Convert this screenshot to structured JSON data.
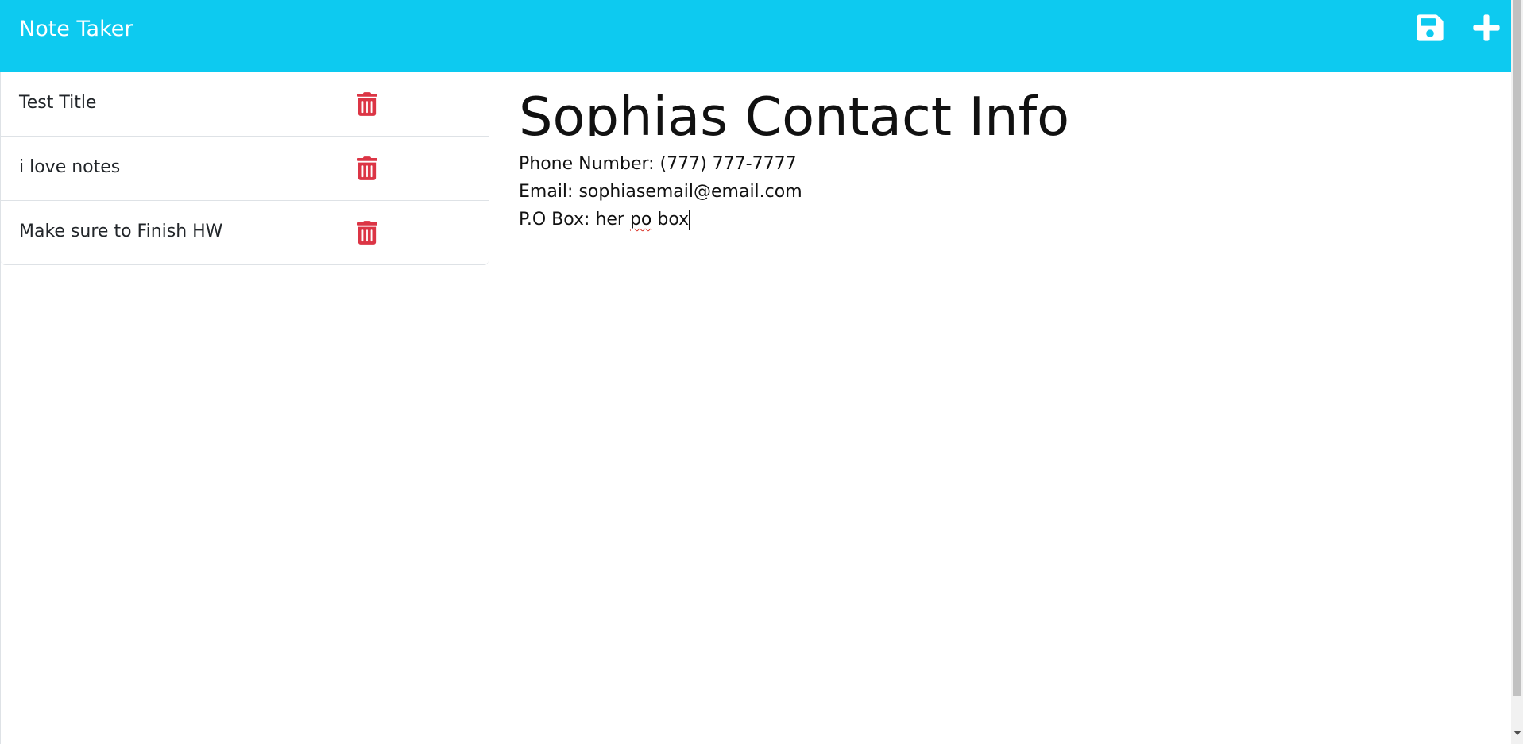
{
  "app": {
    "title": "Note Taker",
    "accent_color": "#0dcaf0",
    "danger_color": "#dc3545"
  },
  "header": {
    "save_icon": "floppy-disk-icon",
    "add_icon": "plus-icon"
  },
  "sidebar": {
    "notes": [
      {
        "title": "Test Title",
        "delete_icon": "trash-icon"
      },
      {
        "title": "i love notes",
        "delete_icon": "trash-icon"
      },
      {
        "title": "Make sure to Finish HW",
        "delete_icon": "trash-icon"
      }
    ]
  },
  "editor": {
    "note_title": "Sophias Contact Info",
    "body_lines": [
      "Phone Number: (777) 777-7777",
      "Email: sophiasemail@email.com"
    ],
    "last_line_prefix": "P.O Box: her ",
    "last_line_misspelled": "po",
    "last_line_suffix": " box"
  }
}
